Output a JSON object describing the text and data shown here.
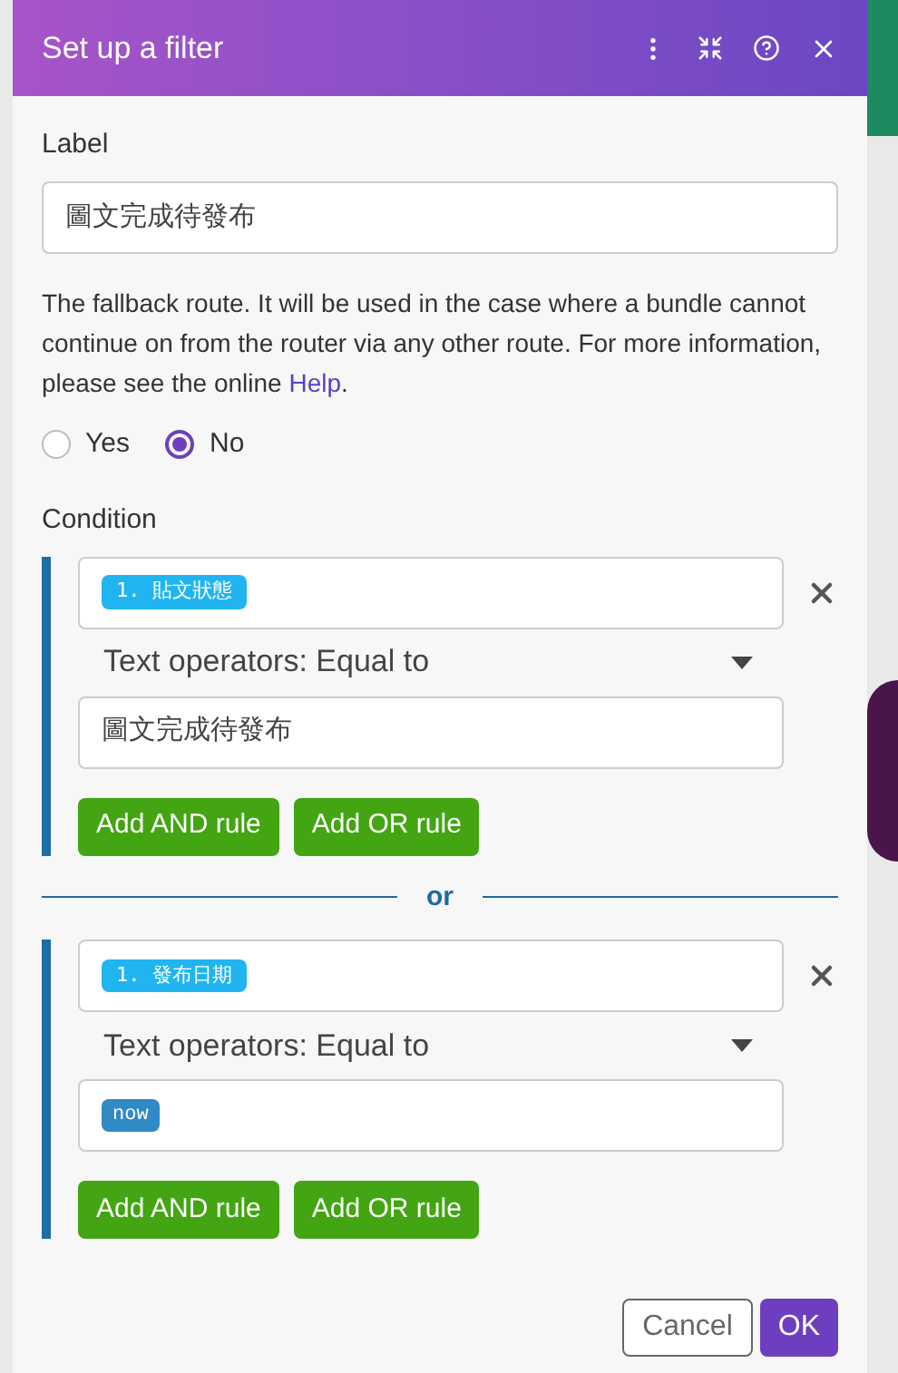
{
  "dialog": {
    "title": "Set up a filter"
  },
  "label_field": {
    "label": "Label",
    "value": "圖文完成待發布"
  },
  "description": {
    "text": "The fallback route. It will be used in the case where a bundle cannot continue on from the router via any other route. For more information, please see the online ",
    "link": "Help",
    "end": "."
  },
  "fallback_options": [
    {
      "label": "Yes",
      "selected": false
    },
    {
      "label": "No",
      "selected": true
    }
  ],
  "condition_label": "Condition",
  "condition_groups": [
    {
      "field_token": "1. 貼文狀態",
      "operator": "Text operators: Equal to",
      "value": {
        "kind": "text",
        "text": "圖文完成待發布"
      },
      "buttons": [
        "Add AND rule",
        "Add OR rule"
      ]
    },
    {
      "field_token": "1. 發布日期",
      "operator": "Text operators: Equal to",
      "value": {
        "kind": "token",
        "text": "now"
      },
      "buttons": [
        "Add AND rule",
        "Add OR rule"
      ]
    }
  ],
  "separator": "or",
  "footer_buttons": [
    {
      "label": "Cancel",
      "kind": "secondary"
    },
    {
      "label": "OK",
      "kind": "primary"
    }
  ]
}
